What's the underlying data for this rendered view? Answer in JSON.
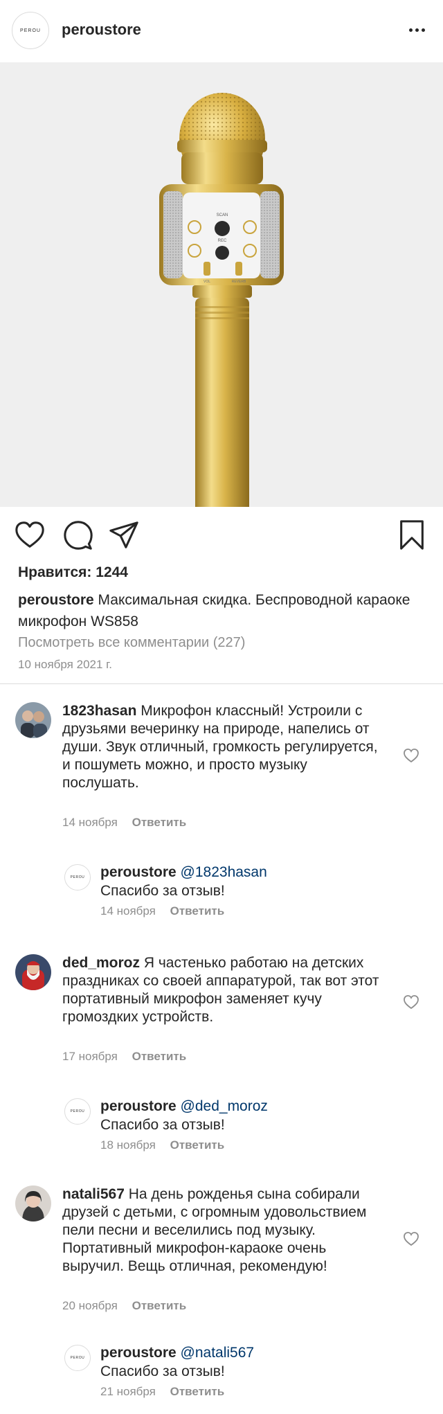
{
  "header": {
    "username": "peroustore",
    "logo_text": "PEROU"
  },
  "post": {
    "likes": "Нравится: 1244",
    "caption_user": "peroustore",
    "caption_text": "Максимальная скидка. Беспроводной караоке микрофон WS858",
    "view_all": "Посмотреть все комментарии (227)",
    "date": "10 ноября 2021 г.",
    "image_labels": {
      "scan": "SCAN",
      "rec": "REC",
      "vol": "VOL",
      "reverb": "REVERB"
    }
  },
  "icons": [
    "heart-icon",
    "comment-icon",
    "share-icon",
    "bookmark-icon",
    "more-icon"
  ],
  "colors": {
    "text": "#262626",
    "secondary": "#8e8e8e",
    "mention": "#00376b",
    "image_bg": "#efefef",
    "gold": "#d9b44a"
  },
  "comments": [
    {
      "user": "1823hasan",
      "text": "Микрофон классный! Устроили с друзьями вечеринку на природе, напелись от души. Звук отличный, громкость регулируется, и пошуметь можно, и просто музыку послушать.",
      "date": "14 ноября",
      "reply_label": "Ответить",
      "response": {
        "user": "peroustore",
        "mention": "@1823hasan",
        "text": "Спасибо за отзыв!",
        "date": "14 ноября",
        "reply_label": "Ответить"
      }
    },
    {
      "user": "ded_moroz",
      "text": "Я частенько работаю на детских праздниках со своей аппаратурой, так вот этот портативный микрофон заменяет кучу громоздких устройств.",
      "date": "17 ноября",
      "reply_label": "Ответить",
      "response": {
        "user": "peroustore",
        "mention": "@ded_moroz",
        "text": "Спасибо за отзыв!",
        "date": "18 ноября",
        "reply_label": "Ответить"
      }
    },
    {
      "user": "natali567",
      "text": "На день рожденья сына собирали друзей с детьми, с огромным удовольствием пели песни и веселились под музыку. Портативный микрофон-караоке очень выручил. Вещь отличная, рекомендую!",
      "date": "20 ноября",
      "reply_label": "Ответить",
      "response": {
        "user": "peroustore",
        "mention": "@natali567",
        "text": "Спасибо за отзыв!",
        "date": "21 ноября",
        "reply_label": "Ответить"
      }
    }
  ]
}
